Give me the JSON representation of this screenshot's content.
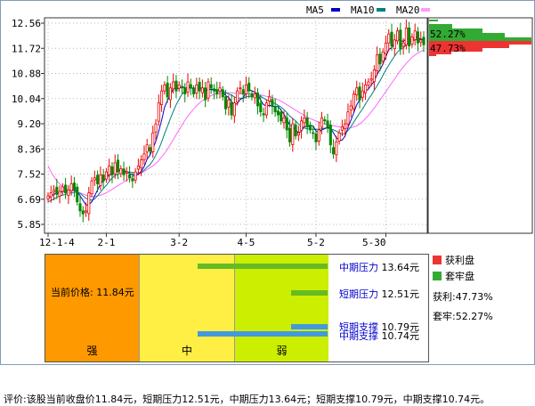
{
  "legend": {
    "ma5": {
      "label": "MA5",
      "color": "#0000cc"
    },
    "ma10": {
      "label": "MA10",
      "color": "#008080"
    },
    "ma20": {
      "label": "MA20",
      "color": "#ff66ff"
    }
  },
  "y_ticks": [
    "12.56",
    "11.72",
    "10.88",
    "10.04",
    "9.20",
    "8.36",
    "7.52",
    "6.69",
    "5.85"
  ],
  "x_ticks": [
    "12-1-4",
    "2-1",
    "3-2",
    "4-5",
    "5-2",
    "5-30"
  ],
  "distribution": {
    "profit_pct": "52.27%",
    "trapped_pct": "47.73%",
    "profit_color": "#33aa33",
    "trapped_color": "#ee3333"
  },
  "zones": {
    "strong": {
      "label": "强",
      "color": "#ff9900"
    },
    "mid": {
      "label": "中",
      "color": "#ffee44"
    },
    "weak": {
      "label": "弱",
      "color": "#ccee00"
    }
  },
  "current_price": "当前价格: 11.84元",
  "levels": [
    {
      "name": "中期压力",
      "value": "13.64元",
      "color": "#66bb22"
    },
    {
      "name": "短期压力",
      "value": "12.51元",
      "color": "#66bb22"
    },
    {
      "name": "短期支撑",
      "value": "10.79元",
      "color": "#4499dd"
    },
    {
      "name": "中期支撑",
      "value": "10.74元",
      "color": "#4499dd"
    }
  ],
  "right_legend": {
    "profit_label": "获利盘",
    "trapped_label": "套牢盘",
    "profit_stat": "获利:47.73%",
    "trapped_stat": "套牢:52.27%"
  },
  "comment": "评价:该股当前收盘价11.84元，短期压力12.51元，中期压力13.64元；短期支撑10.79元，中期支撑10.74元。",
  "chart_data": {
    "type": "line",
    "ylim": [
      5.85,
      12.56
    ],
    "close": [
      6.8,
      6.9,
      7.0,
      6.85,
      6.95,
      7.1,
      6.9,
      7.0,
      7.2,
      7.0,
      6.6,
      6.3,
      6.2,
      6.3,
      6.9,
      7.3,
      7.4,
      7.2,
      7.5,
      7.3,
      7.6,
      7.8,
      7.5,
      7.9,
      7.6,
      7.7,
      7.5,
      7.6,
      7.4,
      7.3,
      7.6,
      7.8,
      8.0,
      8.2,
      8.5,
      8.3,
      8.9,
      9.2,
      9.9,
      10.3,
      10.5,
      10.1,
      10.4,
      10.6,
      10.3,
      10.5,
      10.4,
      10.2,
      10.6,
      10.4,
      10.2,
      10.5,
      10.3,
      10.4,
      10.0,
      10.6,
      10.4,
      10.3,
      10.2,
      10.4,
      10.1,
      9.7,
      10.0,
      9.5,
      9.9,
      10.3,
      10.4,
      10.2,
      10.5,
      10.3,
      10.1,
      10.2,
      9.8,
      9.6,
      9.5,
      9.9,
      10.1,
      9.8,
      9.6,
      9.5,
      9.3,
      9.4,
      9.0,
      8.6,
      9.2,
      8.8,
      8.9,
      9.3,
      9.4,
      9.1,
      9.0,
      8.9,
      8.6,
      9.0,
      9.4,
      9.3,
      9.1,
      8.5,
      8.2,
      8.6,
      8.9,
      9.1,
      9.2,
      9.6,
      9.8,
      10.2,
      10.4,
      10.0,
      10.3,
      10.5,
      10.6,
      10.7,
      11.0,
      11.5,
      11.2,
      11.6,
      11.9,
      12.2,
      11.8,
      12.0,
      12.3,
      11.7,
      11.9,
      12.4,
      11.8,
      12.1,
      12.3,
      11.9,
      12.0,
      11.84
    ],
    "ma5": [
      6.7,
      6.8,
      6.85,
      6.9,
      6.9,
      6.95,
      6.95,
      6.95,
      7.0,
      7.0,
      6.95,
      6.8,
      6.65,
      6.5,
      6.5,
      6.6,
      6.8,
      7.0,
      7.2,
      7.3,
      7.4,
      7.5,
      7.5,
      7.6,
      7.65,
      7.65,
      7.65,
      7.6,
      7.55,
      7.5,
      7.48,
      7.52,
      7.62,
      7.78,
      8.02,
      8.16,
      8.38,
      8.62,
      8.96,
      9.32,
      9.76,
      9.98,
      10.16,
      10.38,
      10.38,
      10.38,
      10.46,
      10.4,
      10.4,
      10.42,
      10.36,
      10.38,
      10.4,
      10.36,
      10.28,
      10.36,
      10.34,
      10.34,
      10.3,
      10.38,
      10.28,
      10.14,
      10.08,
      9.94,
      9.84,
      9.88,
      10.02,
      10.06,
      10.26,
      10.34,
      10.3,
      10.26,
      10.18,
      10.0,
      9.84,
      9.8,
      9.82,
      9.78,
      9.78,
      9.78,
      9.66,
      9.52,
      9.36,
      9.16,
      9.1,
      9.0,
      8.9,
      8.96,
      9.12,
      9.1,
      9.14,
      9.14,
      8.96,
      8.92,
      9.0,
      9.04,
      9.08,
      9.06,
      8.9,
      8.74,
      8.66,
      8.66,
      8.8,
      9.08,
      9.32,
      9.58,
      9.84,
      10.0,
      10.18,
      10.28,
      10.36,
      10.5,
      10.62,
      10.86,
      11.0,
      11.2,
      11.44,
      11.68,
      11.74,
      11.9,
      12.04,
      12.0,
      11.94,
      12.06,
      12.02,
      11.98,
      12.1,
      12.08,
      12.02,
      12.02
    ],
    "ma10": [
      6.6,
      6.65,
      6.7,
      6.75,
      6.8,
      6.82,
      6.85,
      6.88,
      6.9,
      6.92,
      6.92,
      6.88,
      6.8,
      6.72,
      6.68,
      6.65,
      6.7,
      6.8,
      6.92,
      7.05,
      7.15,
      7.28,
      7.4,
      7.48,
      7.52,
      7.55,
      7.58,
      7.6,
      7.6,
      7.58,
      7.56,
      7.56,
      7.58,
      7.66,
      7.76,
      7.84,
      7.98,
      8.16,
      8.36,
      8.6,
      8.88,
      9.12,
      9.38,
      9.62,
      9.84,
      10.02,
      10.2,
      10.3,
      10.38,
      10.4,
      10.4,
      10.4,
      10.4,
      10.4,
      10.36,
      10.36,
      10.36,
      10.36,
      10.34,
      10.32,
      10.3,
      10.24,
      10.2,
      10.16,
      10.1,
      10.06,
      10.06,
      10.06,
      10.1,
      10.12,
      10.12,
      10.14,
      10.14,
      10.12,
      10.06,
      10.0,
      9.96,
      9.92,
      9.88,
      9.82,
      9.76,
      9.68,
      9.58,
      9.46,
      9.38,
      9.3,
      9.2,
      9.12,
      9.06,
      9.04,
      9.02,
      9.02,
      9.02,
      9.02,
      9.04,
      9.06,
      9.06,
      9.04,
      9.0,
      8.96,
      8.9,
      8.86,
      8.88,
      8.98,
      9.1,
      9.26,
      9.42,
      9.56,
      9.7,
      9.86,
      10.02,
      10.16,
      10.32,
      10.48,
      10.64,
      10.82,
      11.0,
      11.16,
      11.32,
      11.46,
      11.6,
      11.68,
      11.74,
      11.84,
      11.92,
      11.96,
      12.0,
      12.02,
      12.02,
      12.02
    ],
    "ma20": [
      7.8,
      7.6,
      7.45,
      7.3,
      7.2,
      7.1,
      7.05,
      7.0,
      6.98,
      6.96,
      6.94,
      6.9,
      6.86,
      6.82,
      6.8,
      6.78,
      6.78,
      6.8,
      6.82,
      6.86,
      6.9,
      6.96,
      7.02,
      7.08,
      7.14,
      7.2,
      7.26,
      7.32,
      7.38,
      7.44,
      7.48,
      7.52,
      7.56,
      7.62,
      7.68,
      7.74,
      7.8,
      7.88,
      7.98,
      8.1,
      8.22,
      8.36,
      8.52,
      8.68,
      8.84,
      9.0,
      9.16,
      9.32,
      9.46,
      9.58,
      9.7,
      9.8,
      9.9,
      9.98,
      10.04,
      10.1,
      10.14,
      10.18,
      10.2,
      10.22,
      10.24,
      10.24,
      10.24,
      10.24,
      10.22,
      10.22,
      10.22,
      10.2,
      10.2,
      10.2,
      10.2,
      10.2,
      10.18,
      10.16,
      10.14,
      10.12,
      10.1,
      10.08,
      10.04,
      10.0,
      9.96,
      9.9,
      9.84,
      9.78,
      9.72,
      9.66,
      9.6,
      9.54,
      9.48,
      9.42,
      9.38,
      9.34,
      9.3,
      9.26,
      9.22,
      9.2,
      9.18,
      9.16,
      9.14,
      9.12,
      9.1,
      9.08,
      9.06,
      9.06,
      9.08,
      9.1,
      9.14,
      9.2,
      9.28,
      9.38,
      9.48,
      9.6,
      9.72,
      9.86,
      10.0,
      10.14,
      10.28,
      10.42,
      10.56,
      10.7,
      10.84,
      10.98,
      11.1,
      11.22,
      11.32,
      11.42,
      11.5,
      11.56,
      11.62,
      11.66
    ]
  }
}
